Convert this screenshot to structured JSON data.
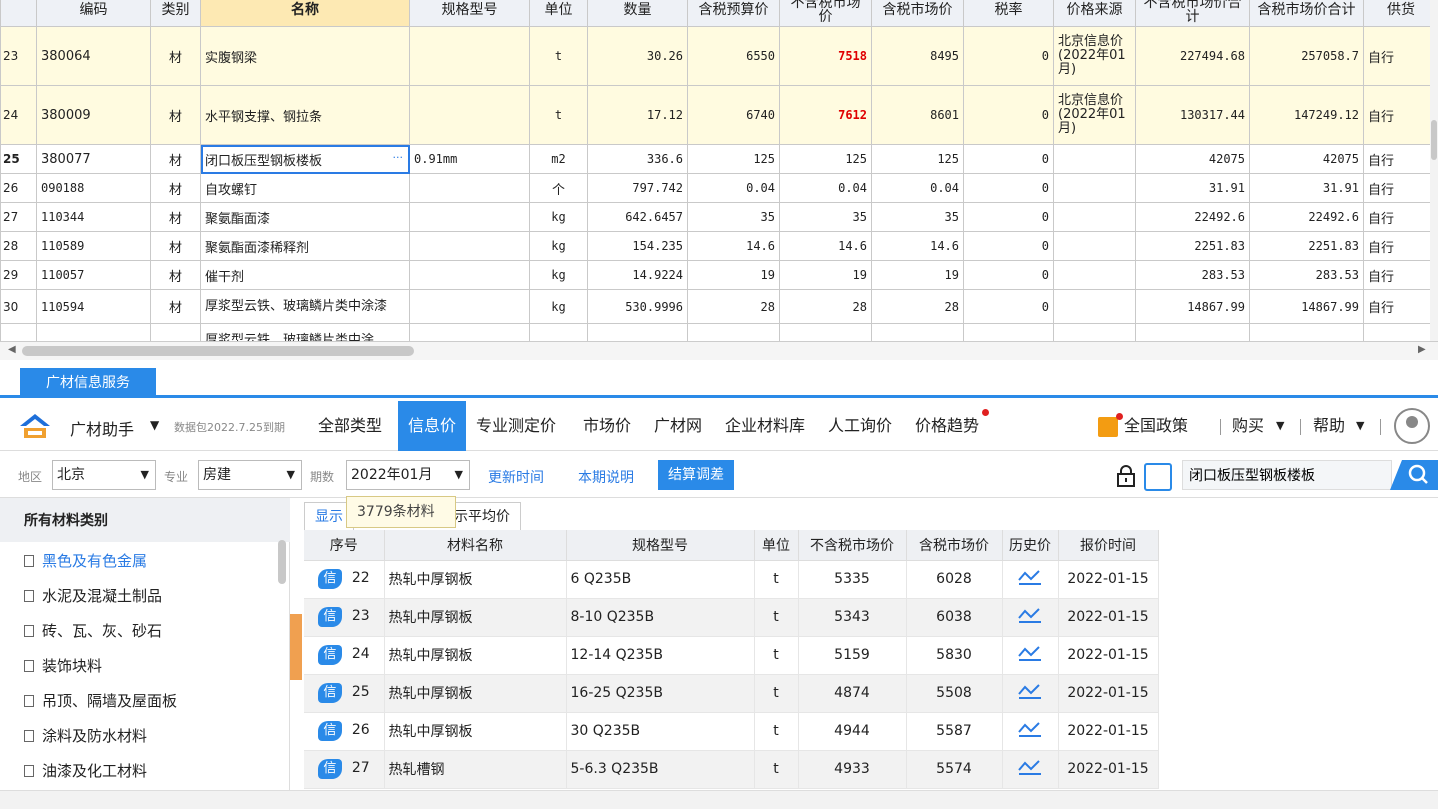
{
  "grid": {
    "headers": [
      "编码",
      "类别",
      "名称",
      "规格型号",
      "单位",
      "数量",
      "含税预算价",
      "不含税市场价",
      "含税市场价",
      "税率",
      "价格来源",
      "不含税市场价合计",
      "含税市场价合计",
      "供货"
    ],
    "rows": [
      {
        "no": "23",
        "code": "380064",
        "cat": "材",
        "name": "实腹钢梁",
        "spec": "",
        "unit": "t",
        "qty": "30.26",
        "budget": "6550",
        "mkt_ex": "7518",
        "mkt_in": "8495",
        "tax": "0",
        "source": "北京信息价(2022年01月)",
        "total_ex": "227494.68",
        "total_in": "257058.7",
        "supply": "自行"
      },
      {
        "no": "24",
        "code": "380009",
        "cat": "材",
        "name": "水平钢支撑、钢拉条",
        "spec": "",
        "unit": "t",
        "qty": "17.12",
        "budget": "6740",
        "mkt_ex": "7612",
        "mkt_in": "8601",
        "tax": "0",
        "source": "北京信息价(2022年01月)",
        "total_ex": "130317.44",
        "total_in": "147249.12",
        "supply": "自行"
      },
      {
        "no": "25",
        "code": "380077",
        "cat": "材",
        "name": "闭口板压型钢板楼板",
        "spec": "0.91mm",
        "unit": "m2",
        "qty": "336.6",
        "budget": "125",
        "mkt_ex": "125",
        "mkt_in": "125",
        "tax": "0",
        "source": "",
        "total_ex": "42075",
        "total_in": "42075",
        "supply": "自行"
      },
      {
        "no": "26",
        "code": "090188",
        "cat": "材",
        "name": "自攻螺钉",
        "spec": "",
        "unit": "个",
        "qty": "797.742",
        "budget": "0.04",
        "mkt_ex": "0.04",
        "mkt_in": "0.04",
        "tax": "0",
        "source": "",
        "total_ex": "31.91",
        "total_in": "31.91",
        "supply": "自行"
      },
      {
        "no": "27",
        "code": "110344",
        "cat": "材",
        "name": "聚氨酯面漆",
        "spec": "",
        "unit": "kg",
        "qty": "642.6457",
        "budget": "35",
        "mkt_ex": "35",
        "mkt_in": "35",
        "tax": "0",
        "source": "",
        "total_ex": "22492.6",
        "total_in": "22492.6",
        "supply": "自行"
      },
      {
        "no": "28",
        "code": "110589",
        "cat": "材",
        "name": "聚氨酯面漆稀释剂",
        "spec": "",
        "unit": "kg",
        "qty": "154.235",
        "budget": "14.6",
        "mkt_ex": "14.6",
        "mkt_in": "14.6",
        "tax": "0",
        "source": "",
        "total_ex": "2251.83",
        "total_in": "2251.83",
        "supply": "自行"
      },
      {
        "no": "29",
        "code": "110057",
        "cat": "材",
        "name": "催干剂",
        "spec": "",
        "unit": "kg",
        "qty": "14.9224",
        "budget": "19",
        "mkt_ex": "19",
        "mkt_in": "19",
        "tax": "0",
        "source": "",
        "total_ex": "283.53",
        "total_in": "283.53",
        "supply": "自行"
      },
      {
        "no": "30",
        "code": "110594",
        "cat": "材",
        "name": "厚浆型云铁、玻璃鳞片类中涂漆",
        "spec": "",
        "unit": "kg",
        "qty": "530.9996",
        "budget": "28",
        "mkt_ex": "28",
        "mkt_in": "28",
        "tax": "0",
        "source": "",
        "total_ex": "14867.99",
        "total_in": "14867.99",
        "supply": "自行"
      },
      {
        "no": "",
        "code": "",
        "cat": "",
        "name": "厚浆型云铁、玻璃鳞片类中涂",
        "spec": "",
        "unit": "",
        "qty": "",
        "budget": "",
        "mkt_ex": "",
        "mkt_in": "",
        "tax": "",
        "source": "",
        "total_ex": "",
        "total_in": "",
        "supply": ""
      }
    ]
  },
  "service_tab": "广材信息服务",
  "toolbar": {
    "brand": "广材助手",
    "db_info": "数据包2022.7.25到期",
    "nav": [
      "全部类型",
      "信息价",
      "专业测定价",
      "市场价",
      "广材网",
      "企业材料库",
      "人工询价",
      "价格趋势"
    ],
    "policy": "全国政策",
    "buy": "购买",
    "help": "帮助"
  },
  "filter": {
    "region_label": "地区",
    "region": "北京",
    "major_label": "专业",
    "major": "房建",
    "period_label": "期数",
    "period": "2022年01月",
    "update_time": "更新时间",
    "period_note": "本期说明",
    "settle": "结算调差",
    "search_value": "闭口板压型钢板楼板"
  },
  "categories": {
    "header": "所有材料类别",
    "items": [
      "黑色及有色金属",
      "水泥及混凝土制品",
      "砖、瓦、灰、砂石",
      "装饰块料",
      "吊顶、隔墙及屋面板",
      "涂料及防水材料",
      "油漆及化工材料"
    ]
  },
  "results": {
    "tab1": "显示",
    "tab2": "示平均价",
    "tooltip": "3779条材料",
    "headers": [
      "序号",
      "材料名称",
      "规格型号",
      "单位",
      "不含税市场价",
      "含税市场价",
      "历史价",
      "报价时间"
    ],
    "badge": "信",
    "rows": [
      {
        "no": "22",
        "name": "热轧中厚钢板",
        "spec": "6 Q235B",
        "unit": "t",
        "ex": "5335",
        "in": "6028",
        "date": "2022-01-15"
      },
      {
        "no": "23",
        "name": "热轧中厚钢板",
        "spec": "8-10 Q235B",
        "unit": "t",
        "ex": "5343",
        "in": "6038",
        "date": "2022-01-15"
      },
      {
        "no": "24",
        "name": "热轧中厚钢板",
        "spec": "12-14 Q235B",
        "unit": "t",
        "ex": "5159",
        "in": "5830",
        "date": "2022-01-15"
      },
      {
        "no": "25",
        "name": "热轧中厚钢板",
        "spec": "16-25 Q235B",
        "unit": "t",
        "ex": "4874",
        "in": "5508",
        "date": "2022-01-15"
      },
      {
        "no": "26",
        "name": "热轧中厚钢板",
        "spec": "30 Q235B",
        "unit": "t",
        "ex": "4944",
        "in": "5587",
        "date": "2022-01-15"
      },
      {
        "no": "27",
        "name": "热轧槽钢",
        "spec": "5-6.3 Q235B",
        "unit": "t",
        "ex": "4933",
        "in": "5574",
        "date": "2022-01-15"
      }
    ]
  },
  "colors": {
    "accent": "#2a8ae8",
    "highlight_red": "#e00000",
    "row_yellow": "#fffbe0",
    "header_highlight": "#fde9b3"
  }
}
